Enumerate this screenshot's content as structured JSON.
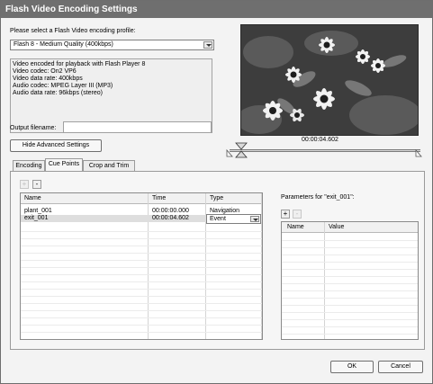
{
  "window": {
    "title": "Flash Video Encoding Settings"
  },
  "profile": {
    "prompt": "Please select a Flash Video encoding profile:",
    "selected": "Flash 8 - Medium Quality (400kbps)"
  },
  "info": {
    "lines": [
      "Video encoded for playback with Flash Player 8",
      "Video codec: On2 VP6",
      "Video data rate: 400kbps",
      "Audio codec: MPEG Layer III (MP3)",
      "Audio data rate: 96kbps (stereo)"
    ]
  },
  "output": {
    "label": "Output filename:",
    "value": ""
  },
  "advanced": {
    "button_label": "Hide Advanced Settings"
  },
  "preview": {
    "timecode": "00:00:04.602"
  },
  "tabs": [
    {
      "label": "Encoding"
    },
    {
      "label": "Cue Points"
    },
    {
      "label": "Crop and Trim"
    }
  ],
  "cuepoints": {
    "add_label": "+",
    "remove_label": "-",
    "columns": [
      "Name",
      "Time",
      "Type"
    ],
    "rows": [
      {
        "name": "plant_001",
        "time": "00:00:00.000",
        "type": "Navigation"
      },
      {
        "name": "exit_001",
        "time": "00:00:04.602",
        "type": "Event"
      }
    ]
  },
  "parameters": {
    "label": "Parameters for \"exit_001\":",
    "add_label": "+",
    "remove_label": "-",
    "columns": [
      "Name",
      "Value"
    ]
  },
  "footer": {
    "ok_label": "OK",
    "cancel_label": "Cancel"
  },
  "colors": {
    "titlebar": "#6f6f6f",
    "selection": "#dedede"
  }
}
